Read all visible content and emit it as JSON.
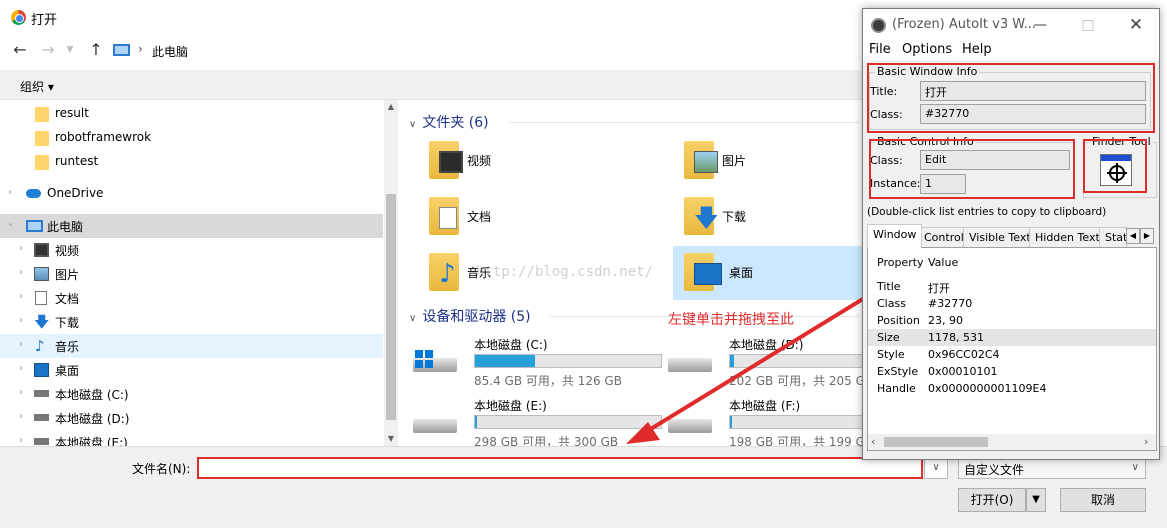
{
  "dialog": {
    "title": "打开",
    "address": {
      "path": "此电脑"
    },
    "toolbar": {
      "organize": "组织 ▾"
    },
    "nav_items": [
      {
        "label": "result",
        "icon": "folder-icon"
      },
      {
        "label": "robotframewrok",
        "icon": "folder-icon"
      },
      {
        "label": "runtest",
        "icon": "folder-icon"
      },
      {
        "label": "OneDrive",
        "icon": "cloud-icon"
      },
      {
        "label": "此电脑",
        "icon": "computer-icon"
      },
      {
        "label": "视频",
        "icon": "video-icon"
      },
      {
        "label": "图片",
        "icon": "picture-icon"
      },
      {
        "label": "文档",
        "icon": "document-icon"
      },
      {
        "label": "下载",
        "icon": "download-icon"
      },
      {
        "label": "音乐",
        "icon": "music-icon"
      },
      {
        "label": "桌面",
        "icon": "desktop-icon"
      },
      {
        "label": "本地磁盘 (C:)",
        "icon": "drive-icon"
      },
      {
        "label": "本地磁盘 (D:)",
        "icon": "drive-icon"
      },
      {
        "label": "本地磁盘 (E:)",
        "icon": "drive-icon"
      }
    ],
    "folders_header": "文件夹 (6)",
    "folders": [
      {
        "label": "视频",
        "icon": "video-folder-icon"
      },
      {
        "label": "图片",
        "icon": "picture-folder-icon"
      },
      {
        "label": "文档",
        "icon": "document-folder-icon"
      },
      {
        "label": "下载",
        "icon": "download-folder-icon"
      },
      {
        "label": "音乐",
        "icon": "music-folder-icon"
      },
      {
        "label": "桌面",
        "icon": "desktop-folder-icon"
      }
    ],
    "drives_header": "设备和驱动器 (5)",
    "drives": [
      {
        "name": "本地磁盘 (C:)",
        "sub": "85.4 GB 可用，共 126 GB",
        "used_fraction": 0.32
      },
      {
        "name": "本地磁盘 (D:)",
        "sub": "202 GB 可用，共 205 GB",
        "used_fraction": 0.015
      },
      {
        "name": "本地磁盘 (E:)",
        "sub": "298 GB 可用，共 300 GB",
        "used_fraction": 0.007
      },
      {
        "name": "本地磁盘 (F:)",
        "sub": "198 GB 可用，共 199 GB",
        "used_fraction": 0.005
      }
    ],
    "filename_label": "文件名(N):",
    "filename_value": "",
    "filetype": "自定义文件",
    "open_button": "打开(O)",
    "cancel_button": "取消"
  },
  "annotation": {
    "text": "左键单击并拖拽至此",
    "watermark": "http://blog.csdn.net/",
    "color": "#e02b2b"
  },
  "autoit": {
    "title": "(Frozen) AutoIt v3 W...",
    "menu": [
      "File",
      "Options",
      "Help"
    ],
    "basic_window_info": {
      "label": "Basic Window Info",
      "title_label": "Title:",
      "title_value": "打开",
      "class_label": "Class:",
      "class_value": "#32770"
    },
    "basic_control_info": {
      "label": "Basic Control Info",
      "class_label": "Class:",
      "class_value": "Edit",
      "instance_label": "Instance:",
      "instance_value": "1"
    },
    "finder_tool_label": "Finder Tool",
    "hint": "(Double-click list entries to copy to clipboard)",
    "tabs": [
      "Window",
      "Control",
      "Visible Text",
      "Hidden Text",
      "Stat"
    ],
    "list_headers": {
      "property": "Property",
      "value": "Value"
    },
    "properties": [
      {
        "property": "Title",
        "value": "打开"
      },
      {
        "property": "Class",
        "value": "#32770"
      },
      {
        "property": "Position",
        "value": "23, 90"
      },
      {
        "property": "Size",
        "value": "1178, 531"
      },
      {
        "property": "Style",
        "value": "0x96CC02C4"
      },
      {
        "property": "ExStyle",
        "value": "0x00010101"
      },
      {
        "property": "Handle",
        "value": "0x0000000001109E4"
      }
    ]
  }
}
